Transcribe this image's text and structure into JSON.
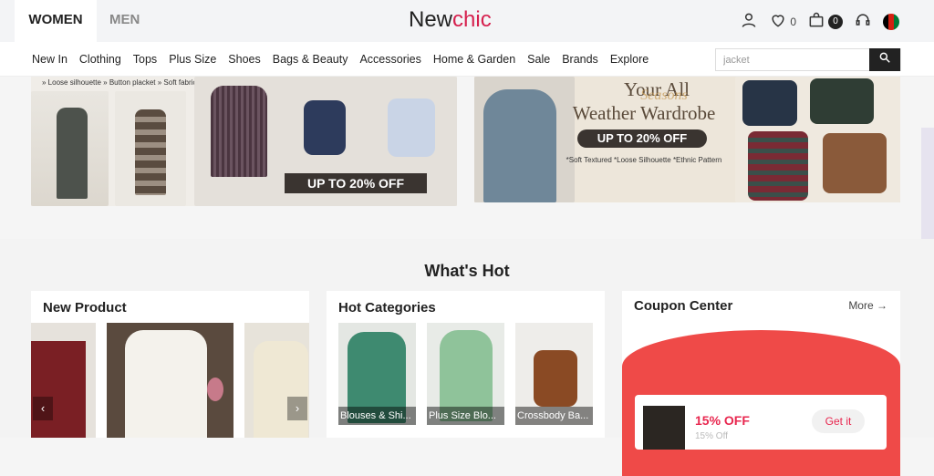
{
  "header": {
    "tabs": [
      "WOMEN",
      "MEN"
    ],
    "logo_a": "New",
    "logo_b": "chic",
    "wishlist_count": "0",
    "cart_count": "0"
  },
  "nav": {
    "items": [
      "New In",
      "Clothing",
      "Tops",
      "Plus Size",
      "Shoes",
      "Bags & Beauty",
      "Accessories",
      "Home & Garden",
      "Sale",
      "Brands",
      "Explore"
    ]
  },
  "search": {
    "value": "jacket"
  },
  "banners": {
    "left": {
      "tags": "» Loose silhouette   » Button placket   » Soft fabric",
      "offer": "UP TO 20% OFF"
    },
    "right": {
      "title_1": "Your All",
      "title_script": "Seasons",
      "title_2": "Weather Wardrobe",
      "offer": "UP TO 20% OFF",
      "features": "*Soft Textured  *Loose Silhouette  *Ethnic Pattern"
    }
  },
  "whats_hot": {
    "title": "What's Hot",
    "new_product": {
      "title": "New Product"
    },
    "hot_categories": {
      "title": "Hot Categories",
      "items": [
        "Blouses & Shi...",
        "Plus Size Blo...",
        "Crossbody Ba..."
      ]
    },
    "coupon_center": {
      "title": "Coupon Center",
      "more": "More →",
      "coupon_pct": "15% OFF",
      "coupon_sub": "15% Off",
      "get_it": "Get it"
    }
  },
  "colors": {
    "brand": "#d6204e",
    "coupon_red": "#ef4a48"
  }
}
